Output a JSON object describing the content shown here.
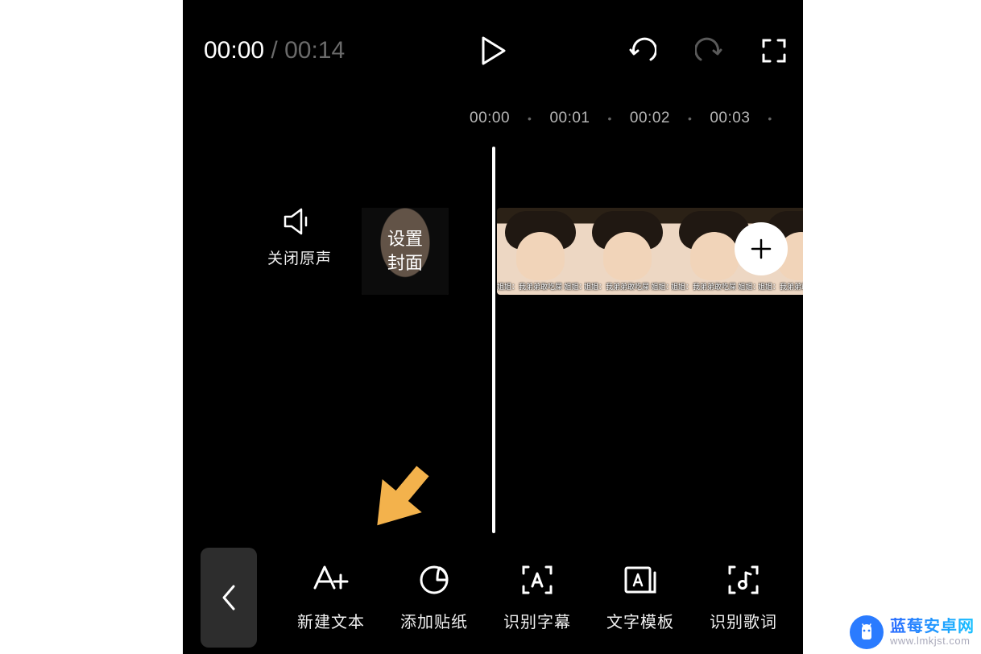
{
  "player": {
    "current_time": "00:00",
    "separator": " / ",
    "total_time": "00:14"
  },
  "ruler": {
    "ticks": [
      "00:00",
      "00:01",
      "00:02",
      "00:03"
    ]
  },
  "audio_toggle": {
    "label": "关闭原声"
  },
  "cover": {
    "label": "设置\n封面"
  },
  "clip": {
    "caption": "姐姐：我弟弟敢吃屎 姐姐：我弟弟敢吃屎 姐姐：你弟弟"
  },
  "toolbar": {
    "items": [
      {
        "id": "new-text",
        "label": "新建文本"
      },
      {
        "id": "add-sticker",
        "label": "添加贴纸"
      },
      {
        "id": "recognize-sub",
        "label": "识别字幕"
      },
      {
        "id": "text-template",
        "label": "文字模板"
      },
      {
        "id": "recognize-lyrics",
        "label": "识别歌词"
      }
    ]
  },
  "watermark": {
    "name": "蓝莓安卓网",
    "url": "www.lmkjst.com"
  },
  "colors": {
    "arrow": "#f3b24c"
  }
}
